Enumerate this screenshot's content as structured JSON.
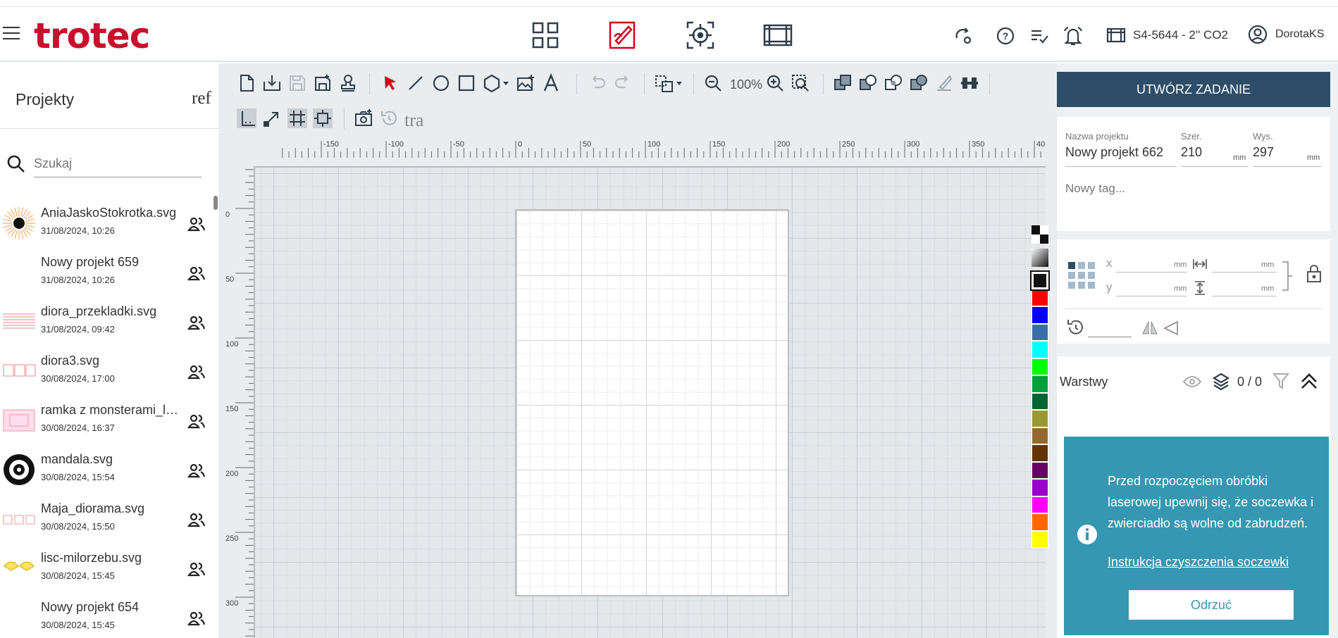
{
  "header": {
    "logo": "trotec",
    "device": "S4-5644 - 2'' CO2",
    "user": "DorotaKS",
    "accent": "#c8102e",
    "nav_icons": [
      "dashboard-grid-icon",
      "design-editor-icon",
      "job-target-icon",
      "film-frame-icon"
    ],
    "right_icons": [
      "sync-settings-icon",
      "help-icon",
      "task-list-icon",
      "bell-icon"
    ]
  },
  "projects": {
    "title": "Projekty",
    "title_extra": "ref",
    "search_placeholder": "Szukaj",
    "files": [
      {
        "name": "AniaJaskoStokrotka.svg",
        "date": "31/08/2024, 10:26",
        "thumb": "sunflower"
      },
      {
        "name": "Nowy projekt 659",
        "date": "31/08/2024, 10:26",
        "thumb": "none"
      },
      {
        "name": "diora_przekladki.svg",
        "date": "31/08/2024, 09:42",
        "thumb": "lines"
      },
      {
        "name": "diora3.svg",
        "date": "30/08/2024, 17:00",
        "thumb": "boxes"
      },
      {
        "name": "ramka z monsterami_lekki_stary ",
        "date": "30/08/2024, 16:37",
        "thumb": "frame"
      },
      {
        "name": "mandala.svg",
        "date": "30/08/2024, 15:54",
        "thumb": "mandala"
      },
      {
        "name": "Maja_diorama.svg",
        "date": "30/08/2024, 15:50",
        "thumb": "boxes2"
      },
      {
        "name": "lisc-milorzebu.svg",
        "date": "30/08/2024, 15:45",
        "thumb": "ginkgo"
      },
      {
        "name": "Nowy projekt 654",
        "date": "30/08/2024, 15:45",
        "thumb": "none"
      }
    ]
  },
  "toolbar": {
    "zoom": "100%",
    "truncated_label": "tra"
  },
  "ruler": {
    "top_labels": [
      "-150",
      "-100",
      "-50",
      "0",
      "50",
      "100",
      "150",
      "200",
      "250",
      "300",
      "350",
      "40"
    ],
    "left_labels": [
      "0",
      "50",
      "100",
      "150",
      "200",
      "250",
      "300"
    ]
  },
  "palette": [
    "#111111",
    "#ff0000",
    "#0000ff",
    "#3a6ea8",
    "#00ffff",
    "#00ff00",
    "#00a13a",
    "#006633",
    "#999933",
    "#996633",
    "#663300",
    "#660066",
    "#9900cc",
    "#ff00ff",
    "#ff6600",
    "#ffff00"
  ],
  "right": {
    "create_job": "UTWÓRZ ZADANIE",
    "project_name_label": "Nazwa projektu",
    "project_name": "Nowy projekt 662",
    "width_label": "Szer.",
    "width": "210",
    "height_label": "Wys.",
    "height": "297",
    "unit": "mm",
    "tag_placeholder": "Nowy tag...",
    "x_label": "x",
    "y_label": "y",
    "layers_label": "Warstwy",
    "layers_count": "0 / 0"
  },
  "toast": {
    "message": "Przed rozpoczęciem obróbki laserowej upewnij się, że soczewka i zwierciadło są wolne od zabrudzeń.",
    "link": "Instrukcja czyszczenia soczewki",
    "dismiss": "Odrzuć",
    "bg": "#3797b3"
  }
}
